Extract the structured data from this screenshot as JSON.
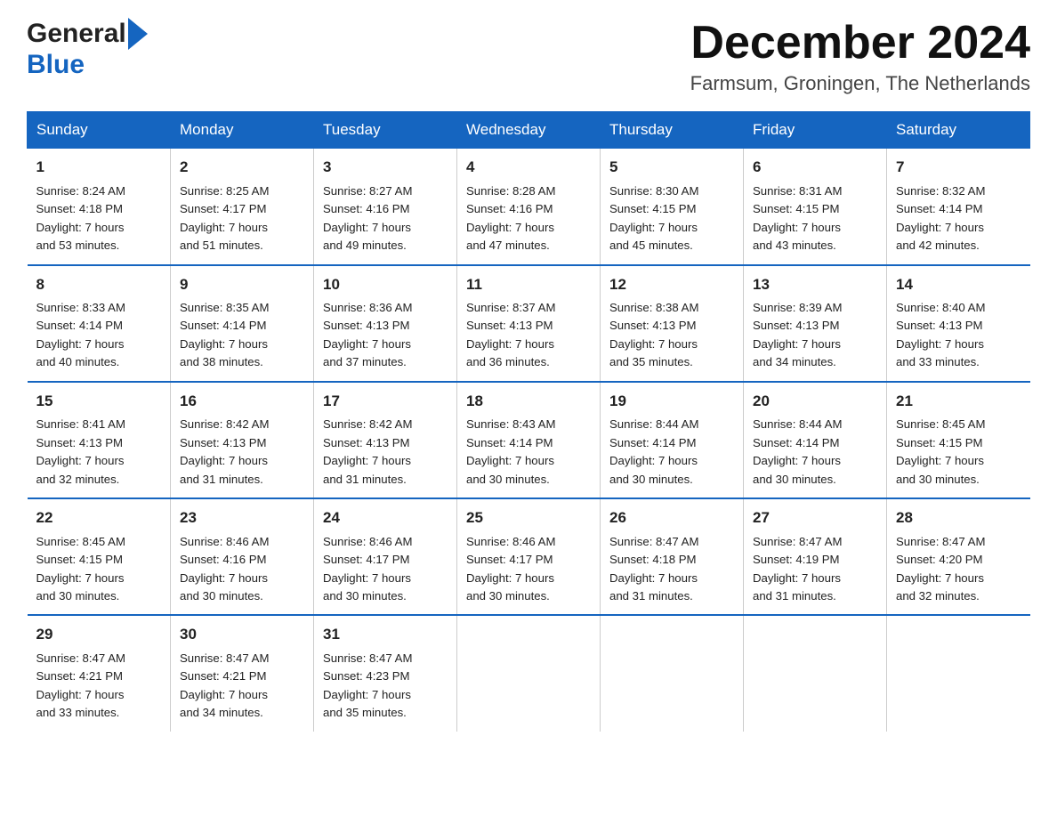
{
  "header": {
    "logo_general": "General",
    "logo_blue": "Blue",
    "month_title": "December 2024",
    "location": "Farmsum, Groningen, The Netherlands"
  },
  "days_of_week": [
    "Sunday",
    "Monday",
    "Tuesday",
    "Wednesday",
    "Thursday",
    "Friday",
    "Saturday"
  ],
  "weeks": [
    [
      {
        "day": "1",
        "sunrise": "8:24 AM",
        "sunset": "4:18 PM",
        "daylight": "7 hours and 53 minutes."
      },
      {
        "day": "2",
        "sunrise": "8:25 AM",
        "sunset": "4:17 PM",
        "daylight": "7 hours and 51 minutes."
      },
      {
        "day": "3",
        "sunrise": "8:27 AM",
        "sunset": "4:16 PM",
        "daylight": "7 hours and 49 minutes."
      },
      {
        "day": "4",
        "sunrise": "8:28 AM",
        "sunset": "4:16 PM",
        "daylight": "7 hours and 47 minutes."
      },
      {
        "day": "5",
        "sunrise": "8:30 AM",
        "sunset": "4:15 PM",
        "daylight": "7 hours and 45 minutes."
      },
      {
        "day": "6",
        "sunrise": "8:31 AM",
        "sunset": "4:15 PM",
        "daylight": "7 hours and 43 minutes."
      },
      {
        "day": "7",
        "sunrise": "8:32 AM",
        "sunset": "4:14 PM",
        "daylight": "7 hours and 42 minutes."
      }
    ],
    [
      {
        "day": "8",
        "sunrise": "8:33 AM",
        "sunset": "4:14 PM",
        "daylight": "7 hours and 40 minutes."
      },
      {
        "day": "9",
        "sunrise": "8:35 AM",
        "sunset": "4:14 PM",
        "daylight": "7 hours and 38 minutes."
      },
      {
        "day": "10",
        "sunrise": "8:36 AM",
        "sunset": "4:13 PM",
        "daylight": "7 hours and 37 minutes."
      },
      {
        "day": "11",
        "sunrise": "8:37 AM",
        "sunset": "4:13 PM",
        "daylight": "7 hours and 36 minutes."
      },
      {
        "day": "12",
        "sunrise": "8:38 AM",
        "sunset": "4:13 PM",
        "daylight": "7 hours and 35 minutes."
      },
      {
        "day": "13",
        "sunrise": "8:39 AM",
        "sunset": "4:13 PM",
        "daylight": "7 hours and 34 minutes."
      },
      {
        "day": "14",
        "sunrise": "8:40 AM",
        "sunset": "4:13 PM",
        "daylight": "7 hours and 33 minutes."
      }
    ],
    [
      {
        "day": "15",
        "sunrise": "8:41 AM",
        "sunset": "4:13 PM",
        "daylight": "7 hours and 32 minutes."
      },
      {
        "day": "16",
        "sunrise": "8:42 AM",
        "sunset": "4:13 PM",
        "daylight": "7 hours and 31 minutes."
      },
      {
        "day": "17",
        "sunrise": "8:42 AM",
        "sunset": "4:13 PM",
        "daylight": "7 hours and 31 minutes."
      },
      {
        "day": "18",
        "sunrise": "8:43 AM",
        "sunset": "4:14 PM",
        "daylight": "7 hours and 30 minutes."
      },
      {
        "day": "19",
        "sunrise": "8:44 AM",
        "sunset": "4:14 PM",
        "daylight": "7 hours and 30 minutes."
      },
      {
        "day": "20",
        "sunrise": "8:44 AM",
        "sunset": "4:14 PM",
        "daylight": "7 hours and 30 minutes."
      },
      {
        "day": "21",
        "sunrise": "8:45 AM",
        "sunset": "4:15 PM",
        "daylight": "7 hours and 30 minutes."
      }
    ],
    [
      {
        "day": "22",
        "sunrise": "8:45 AM",
        "sunset": "4:15 PM",
        "daylight": "7 hours and 30 minutes."
      },
      {
        "day": "23",
        "sunrise": "8:46 AM",
        "sunset": "4:16 PM",
        "daylight": "7 hours and 30 minutes."
      },
      {
        "day": "24",
        "sunrise": "8:46 AM",
        "sunset": "4:17 PM",
        "daylight": "7 hours and 30 minutes."
      },
      {
        "day": "25",
        "sunrise": "8:46 AM",
        "sunset": "4:17 PM",
        "daylight": "7 hours and 30 minutes."
      },
      {
        "day": "26",
        "sunrise": "8:47 AM",
        "sunset": "4:18 PM",
        "daylight": "7 hours and 31 minutes."
      },
      {
        "day": "27",
        "sunrise": "8:47 AM",
        "sunset": "4:19 PM",
        "daylight": "7 hours and 31 minutes."
      },
      {
        "day": "28",
        "sunrise": "8:47 AM",
        "sunset": "4:20 PM",
        "daylight": "7 hours and 32 minutes."
      }
    ],
    [
      {
        "day": "29",
        "sunrise": "8:47 AM",
        "sunset": "4:21 PM",
        "daylight": "7 hours and 33 minutes."
      },
      {
        "day": "30",
        "sunrise": "8:47 AM",
        "sunset": "4:21 PM",
        "daylight": "7 hours and 34 minutes."
      },
      {
        "day": "31",
        "sunrise": "8:47 AM",
        "sunset": "4:23 PM",
        "daylight": "7 hours and 35 minutes."
      },
      null,
      null,
      null,
      null
    ]
  ],
  "labels": {
    "sunrise": "Sunrise:",
    "sunset": "Sunset:",
    "daylight": "Daylight:"
  }
}
